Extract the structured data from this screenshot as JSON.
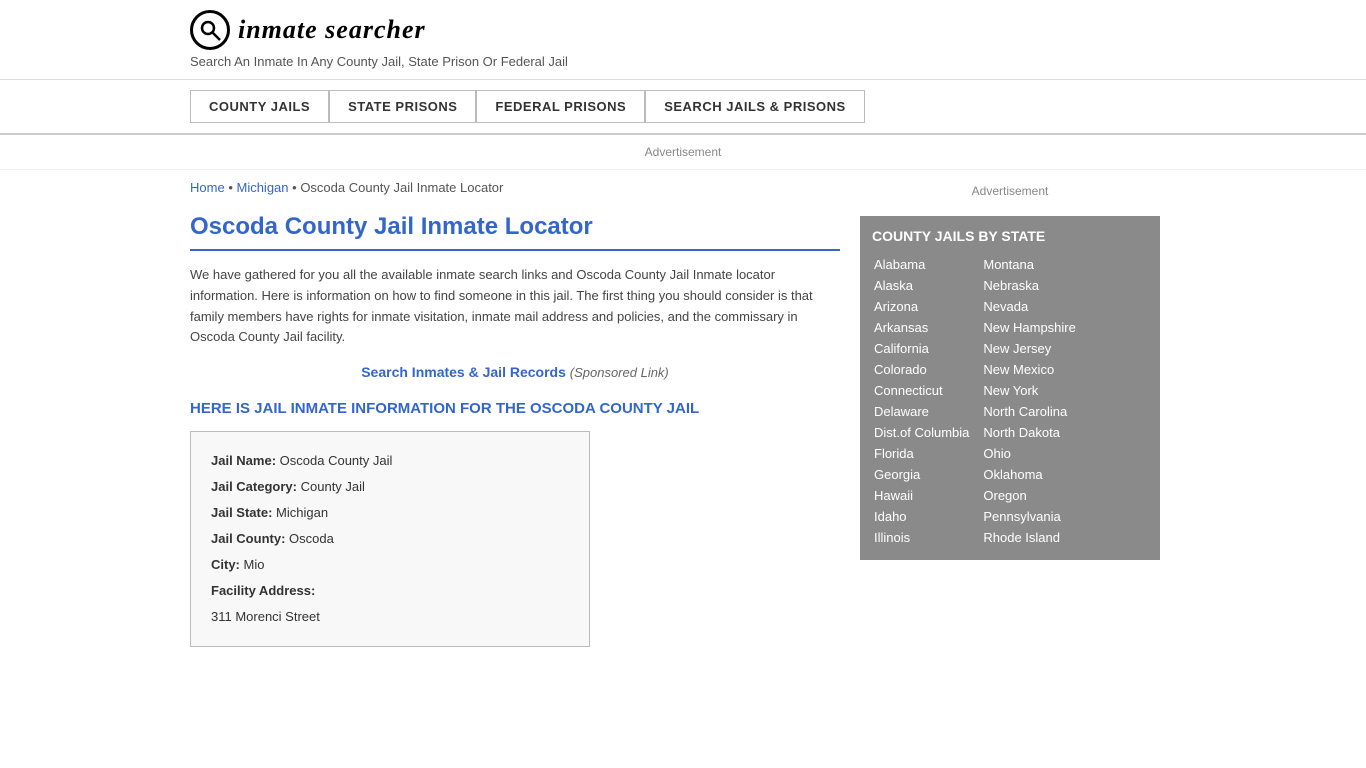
{
  "header": {
    "logo_icon": "🔍",
    "logo_text_main": "inmate searcher",
    "tagline": "Search An Inmate In Any County Jail, State Prison Or Federal Jail"
  },
  "nav": {
    "items": [
      {
        "label": "COUNTY JAILS",
        "href": "#"
      },
      {
        "label": "STATE PRISONS",
        "href": "#"
      },
      {
        "label": "FEDERAL PRISONS",
        "href": "#"
      },
      {
        "label": "SEARCH JAILS & PRISONS",
        "href": "#"
      }
    ]
  },
  "ad_label": "Advertisement",
  "breadcrumb": {
    "home": "Home",
    "state": "Michigan",
    "current": "Oscoda County Jail Inmate Locator"
  },
  "page_title": "Oscoda County Jail Inmate Locator",
  "description": "We have gathered for you all the available inmate search links and Oscoda County Jail Inmate locator information. Here is information on how to find someone in this jail. The first thing you should consider is that family members have rights for inmate visitation, inmate mail address and policies, and the commissary in Oscoda County Jail facility.",
  "sponsored": {
    "link_text": "Search Inmates & Jail Records",
    "note": "(Sponsored Link)"
  },
  "jail_info_heading": "HERE IS JAIL INMATE INFORMATION FOR THE OSCODA COUNTY JAIL",
  "jail_info": {
    "jail_name_label": "Jail Name:",
    "jail_name_value": "Oscoda County Jail",
    "jail_category_label": "Jail Category:",
    "jail_category_value": "County Jail",
    "jail_state_label": "Jail State:",
    "jail_state_value": "Michigan",
    "jail_county_label": "Jail County:",
    "jail_county_value": "Oscoda",
    "city_label": "City:",
    "city_value": "Mio",
    "facility_address_label": "Facility Address:",
    "facility_address_value": "311 Morenci Street"
  },
  "sidebar": {
    "ad_label": "Advertisement",
    "state_box_title": "COUNTY JAILS BY STATE",
    "states_col1": [
      "Alabama",
      "Alaska",
      "Arizona",
      "Arkansas",
      "California",
      "Colorado",
      "Connecticut",
      "Delaware",
      "Dist.of Columbia",
      "Florida",
      "Georgia",
      "Hawaii",
      "Idaho",
      "Illinois"
    ],
    "states_col2": [
      "Montana",
      "Nebraska",
      "Nevada",
      "New Hampshire",
      "New Jersey",
      "New Mexico",
      "New York",
      "North Carolina",
      "North Dakota",
      "Ohio",
      "Oklahoma",
      "Oregon",
      "Pennsylvania",
      "Rhode Island"
    ]
  }
}
